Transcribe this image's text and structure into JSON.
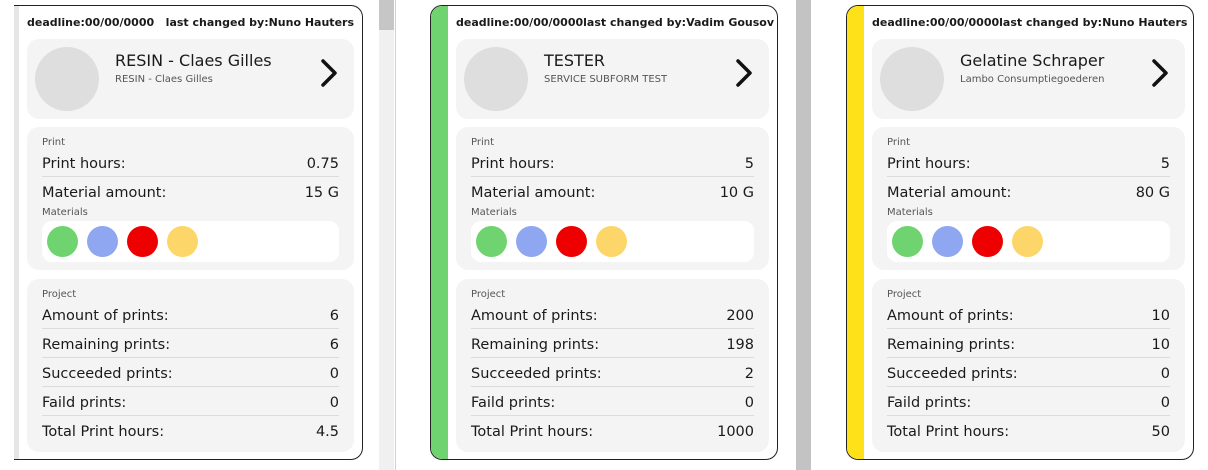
{
  "cards": [
    {
      "deadline_label": "deadline:",
      "deadline": "00/00/0000",
      "changed_label": "last changed by:",
      "changed_by": "Nuno Hauters",
      "title": "RESIN - Claes Gilles",
      "subtitle": "RESIN - Claes Gilles",
      "stripe_color": "#e6e6e6",
      "print_label": "Print",
      "print_hours_label": "Print hours:",
      "print_hours": "0.75",
      "material_amount_label": "Material amount:",
      "material_amount": "15 G",
      "materials_label": "Materials",
      "materials": [
        "#6fd46f",
        "#8fa6f0",
        "#ee0000",
        "#fdd66a"
      ],
      "project_label": "Project",
      "amount_label": "Amount of prints:",
      "amount": "6",
      "remaining_label": "Remaining prints:",
      "remaining": "6",
      "succeeded_label": "Succeeded prints:",
      "succeeded": "0",
      "failed_label": "Faild prints:",
      "failed": "0",
      "total_label": "Total Print hours:",
      "total": "4.5"
    },
    {
      "deadline_label": "deadline:",
      "deadline": "00/00/0000",
      "changed_label": "last changed by:",
      "changed_by": "Vadim Gousov",
      "title": "TESTER",
      "subtitle": "SERVICE SUBFORM TEST",
      "stripe_color": "#6fd46f",
      "print_label": "Print",
      "print_hours_label": "Print hours:",
      "print_hours": "5",
      "material_amount_label": "Material amount:",
      "material_amount": "10 G",
      "materials_label": "Materials",
      "materials": [
        "#6fd46f",
        "#8fa6f0",
        "#ee0000",
        "#fdd66a"
      ],
      "project_label": "Project",
      "amount_label": "Amount of prints:",
      "amount": "200",
      "remaining_label": "Remaining prints:",
      "remaining": "198",
      "succeeded_label": "Succeeded prints:",
      "succeeded": "2",
      "failed_label": "Faild prints:",
      "failed": "0",
      "total_label": "Total Print hours:",
      "total": "1000"
    },
    {
      "deadline_label": "deadline:",
      "deadline": "00/00/0000",
      "changed_label": "last changed by:",
      "changed_by": "Nuno Hauters",
      "title": "Gelatine Schraper",
      "subtitle": "Lambo Consumptiegoederen",
      "stripe_color": "#ffe119",
      "print_label": "Print",
      "print_hours_label": "Print hours:",
      "print_hours": "5",
      "material_amount_label": "Material amount:",
      "material_amount": "80 G",
      "materials_label": "Materials",
      "materials": [
        "#6fd46f",
        "#8fa6f0",
        "#ee0000",
        "#fdd66a"
      ],
      "project_label": "Project",
      "amount_label": "Amount of prints:",
      "amount": "10",
      "remaining_label": "Remaining prints:",
      "remaining": "10",
      "succeeded_label": "Succeeded prints:",
      "succeeded": "0",
      "failed_label": "Faild prints:",
      "failed": "0",
      "total_label": "Total Print hours:",
      "total": "50"
    }
  ]
}
